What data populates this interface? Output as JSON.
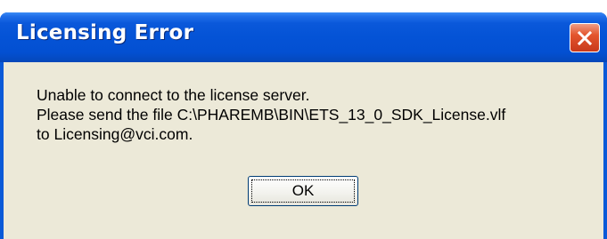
{
  "dialog": {
    "title": "Licensing Error",
    "close_icon": "close-x-icon",
    "message_lines": [
      "Unable to connect to the license server.",
      "Please send the file C:\\PHAREMB\\BIN\\ETS_13_0_SDK_License.vlf",
      "to Licensing@vci.com."
    ],
    "ok_label": "OK"
  },
  "colors": {
    "titlebar": "#0453d6",
    "close_button": "#e3552d",
    "dialog_face": "#ece9d8"
  }
}
